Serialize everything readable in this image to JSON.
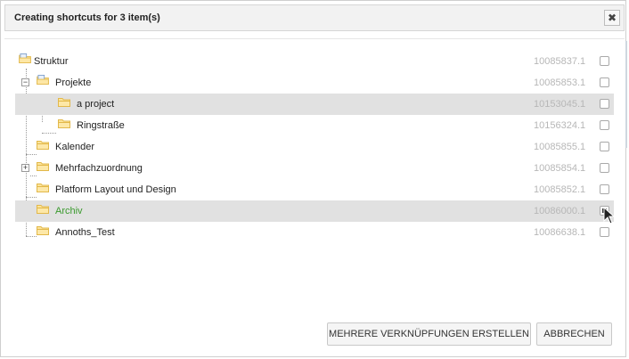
{
  "dialog": {
    "title": "Creating shortcuts for 3 item(s)",
    "close_symbol": "✖"
  },
  "tree": {
    "rows": [
      {
        "label": "Struktur",
        "id": "10085837.1",
        "icon": "root-folder-icon",
        "checked": false,
        "highlighted": false
      },
      {
        "label": "Projekte",
        "id": "10085853.1",
        "icon": "root-folder-icon",
        "checked": false,
        "highlighted": false,
        "expander": "minus"
      },
      {
        "label": "a project",
        "id": "10153045.1",
        "icon": "folder-icon",
        "checked": false,
        "highlighted": true
      },
      {
        "label": "Ringstraße",
        "id": "10156324.1",
        "icon": "folder-icon",
        "checked": false,
        "highlighted": false
      },
      {
        "label": "Kalender",
        "id": "10085855.1",
        "icon": "folder-icon",
        "checked": false,
        "highlighted": false
      },
      {
        "label": "Mehrfachzuordnung",
        "id": "10085854.1",
        "icon": "folder-icon",
        "checked": false,
        "highlighted": false,
        "expander": "plus"
      },
      {
        "label": "Platform Layout und Design",
        "id": "10085852.1",
        "icon": "folder-icon",
        "checked": false,
        "highlighted": false
      },
      {
        "label": "Archiv",
        "id": "10086000.1",
        "icon": "folder-icon",
        "checked": true,
        "highlighted": true,
        "label_color": "#3a9a2d"
      },
      {
        "label": "Annoths_Test",
        "id": "10086638.1",
        "icon": "folder-icon",
        "checked": false,
        "highlighted": false
      }
    ]
  },
  "footer": {
    "create_label": "MEHRERE VERKNÜPFUNGEN ERSTELLEN",
    "cancel_label": "ABBRECHEN"
  },
  "colors": {
    "highlight": "#e1e1e1",
    "folder_fill": "#fce49a",
    "folder_stroke": "#e2b84a",
    "green_label": "#3a9a2d",
    "id_text": "#b7b7b7"
  }
}
